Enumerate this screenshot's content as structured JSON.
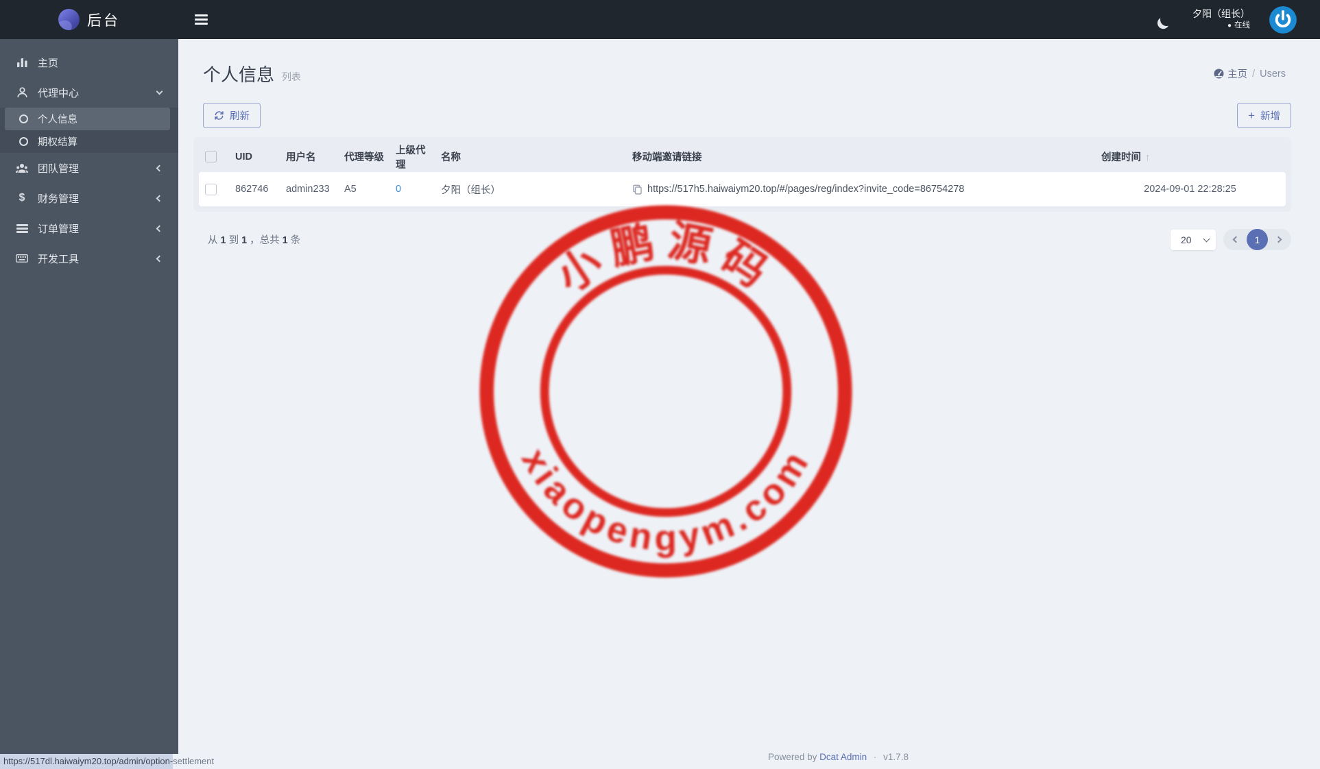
{
  "topbar": {
    "logo_text": "后台",
    "user_name": "夕阳（组长）",
    "status_dot": "●",
    "user_status": "在线"
  },
  "sidebar": {
    "home": "主页",
    "agent_center": "代理中心",
    "personal_info": "个人信息",
    "option_settlement": "期权结算",
    "team_mgmt": "团队管理",
    "finance_mgmt": "财务管理",
    "order_mgmt": "订单管理",
    "dev_tools": "开发工具",
    "dollar_glyph": "$"
  },
  "page": {
    "title": "个人信息",
    "subtitle": "列表",
    "breadcrumb": {
      "home": "主页",
      "separator": "/",
      "current": "Users"
    }
  },
  "toolbar": {
    "refresh_label": "刷新",
    "add_label": "新增",
    "plus_glyph": "+"
  },
  "table": {
    "headers": {
      "uid": "UID",
      "username": "用户名",
      "level": "代理等级",
      "parent": "上级代理",
      "name": "名称",
      "invite": "移动端邀请链接",
      "created": "创建时间",
      "sort_arrow": "↑"
    },
    "row": {
      "uid": "862746",
      "username": "admin233",
      "level": "A5",
      "parent": "0",
      "name": "夕阳（组长）",
      "invite": "https://517h5.haiwaiym20.top/#/pages/reg/index?invite_code=86754278",
      "created": "2024-09-01 22:28:25"
    }
  },
  "pagination": {
    "summary": {
      "t1": "从",
      "n1": "1",
      "t2": "到",
      "n2": "1",
      "t3": "，总共",
      "n3": "1",
      "t4": "条"
    },
    "page_size": "20",
    "current_page": "1"
  },
  "stamp": {
    "top_text": "小鹏源码",
    "bottom_text": "xiaopengym.com",
    "color": "#dc1810"
  },
  "footer": {
    "prefix": "Powered by",
    "brand": "Dcat Admin",
    "separator": "·",
    "version": "v1.7.8"
  },
  "statusbar": {
    "url_main": "https://517dl.haiwaiym20.top/admin/option-",
    "url_tail": "settlement"
  },
  "colors": {
    "primary": "#5b6fb5",
    "link_blue": "#3b8cde",
    "topbar_bg": "#20262d",
    "sidebar_bg": "#4b5461",
    "stamp_red": "#dc1810"
  }
}
